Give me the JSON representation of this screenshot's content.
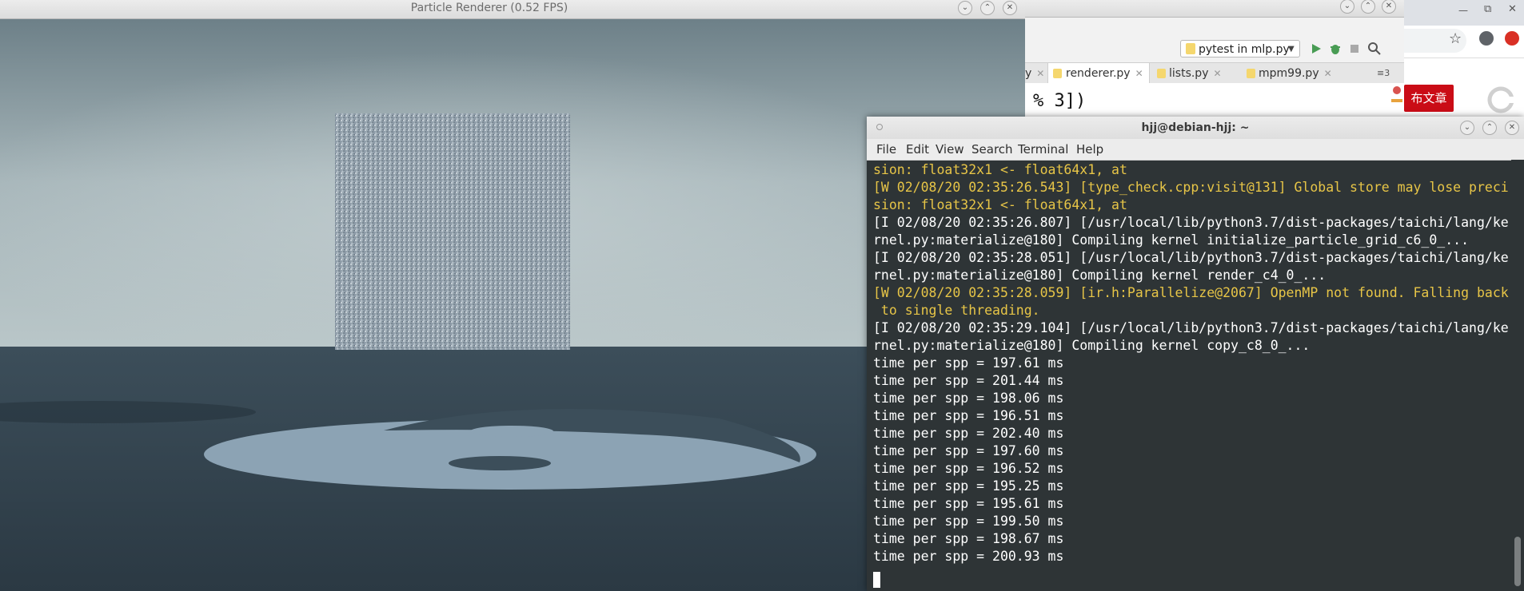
{
  "renderer": {
    "title": "Particle Renderer (0.52 FPS)",
    "buttons": [
      "⌄",
      "⌃",
      "✕"
    ]
  },
  "ide": {
    "run_config": "pytest in mlp.py",
    "tabs": [
      {
        "label": "y"
      },
      {
        "label": "renderer.py",
        "active": true
      },
      {
        "label": "lists.py"
      },
      {
        "label": "mpm99.py"
      }
    ],
    "tabs_overflow": "≡3",
    "code_line": "% 3])",
    "buttons": [
      "⌄",
      "⌃",
      "✕"
    ]
  },
  "browser": {
    "publish_label": "布文章",
    "window_controls": [
      "—",
      "⧉",
      "✕"
    ]
  },
  "terminal": {
    "title": "hjj@debian-hjj: ~",
    "menu": [
      "File",
      "Edit",
      "View",
      "Search",
      "Terminal",
      "Help"
    ],
    "buttons": [
      "⌄",
      "⌃",
      "✕"
    ],
    "lines": [
      {
        "text": "sion: float32x1 <- float64x1, at",
        "kind": "warn"
      },
      {
        "text": "[W 02/08/20 02:35:26.543] [type_check.cpp:visit@131] Global store may lose preci",
        "kind": "warn"
      },
      {
        "text": "sion: float32x1 <- float64x1, at",
        "kind": "warn"
      },
      {
        "text": "[I 02/08/20 02:35:26.807] [/usr/local/lib/python3.7/dist-packages/taichi/lang/ke",
        "kind": "info"
      },
      {
        "text": "rnel.py:materialize@180] Compiling kernel initialize_particle_grid_c6_0_...",
        "kind": "info"
      },
      {
        "text": "[I 02/08/20 02:35:28.051] [/usr/local/lib/python3.7/dist-packages/taichi/lang/ke",
        "kind": "info"
      },
      {
        "text": "rnel.py:materialize@180] Compiling kernel render_c4_0_...",
        "kind": "info"
      },
      {
        "text": "[W 02/08/20 02:35:28.059] [ir.h:Parallelize@2067] OpenMP not found. Falling back",
        "kind": "warn"
      },
      {
        "text": " to single threading.",
        "kind": "warn"
      },
      {
        "text": "[I 02/08/20 02:35:29.104] [/usr/local/lib/python3.7/dist-packages/taichi/lang/ke",
        "kind": "info"
      },
      {
        "text": "rnel.py:materialize@180] Compiling kernel copy_c8_0_...",
        "kind": "info"
      },
      {
        "text": "time per spp = 197.61 ms",
        "kind": "info"
      },
      {
        "text": "time per spp = 201.44 ms",
        "kind": "info"
      },
      {
        "text": "time per spp = 198.06 ms",
        "kind": "info"
      },
      {
        "text": "time per spp = 196.51 ms",
        "kind": "info"
      },
      {
        "text": "time per spp = 202.40 ms",
        "kind": "info"
      },
      {
        "text": "time per spp = 197.60 ms",
        "kind": "info"
      },
      {
        "text": "time per spp = 196.52 ms",
        "kind": "info"
      },
      {
        "text": "time per spp = 195.25 ms",
        "kind": "info"
      },
      {
        "text": "time per spp = 195.61 ms",
        "kind": "info"
      },
      {
        "text": "time per spp = 199.50 ms",
        "kind": "info"
      },
      {
        "text": "time per spp = 198.67 ms",
        "kind": "info"
      },
      {
        "text": "time per spp = 200.93 ms",
        "kind": "info"
      }
    ]
  }
}
